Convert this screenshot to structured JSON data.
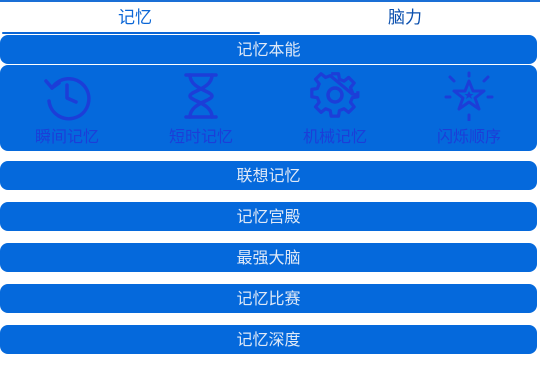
{
  "tabs": [
    {
      "label": "记忆",
      "active": true
    },
    {
      "label": "脑力",
      "active": false
    }
  ],
  "sections": {
    "header_bar": "记忆本能",
    "items": [
      {
        "label": "瞬间记忆",
        "icon": "history-clock-icon"
      },
      {
        "label": "短时记忆",
        "icon": "hourglass-icon"
      },
      {
        "label": "机械记忆",
        "icon": "gear-icon"
      },
      {
        "label": "闪烁顺序",
        "icon": "sparkle-star-icon"
      }
    ],
    "bars": [
      "联想记忆",
      "记忆宫殿",
      "最强大脑",
      "记忆比赛",
      "记忆深度"
    ]
  },
  "colors": {
    "accent": "#0b66d6",
    "bar_bg": "#0569dc",
    "bar_text": "#dfe9f7",
    "icon_color": "#1c3ed8"
  }
}
